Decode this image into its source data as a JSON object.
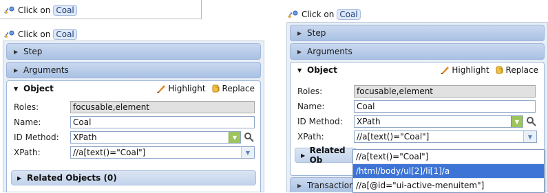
{
  "header": {
    "prefix": "Click on",
    "target": "Coal"
  },
  "bars": {
    "step": "Step",
    "arguments": "Arguments",
    "transactions": "Transactions"
  },
  "object": {
    "title": "Object",
    "highlight": "Highlight",
    "replace": "Replace",
    "labels": {
      "roles": "Roles:",
      "name": "Name:",
      "id_method": "ID Method:",
      "xpath": "XPath:"
    },
    "values": {
      "roles": "focusable,element",
      "name": "Coal",
      "id_method": "XPath",
      "xpath": "//a[text()=\"Coal\"]"
    }
  },
  "related": {
    "full": "Related Objects (0)",
    "truncated": "Related Ob"
  },
  "xpath_options": [
    "//a[text()=\"Coal\"]",
    "/html/body/ul[2]/li[1]/a",
    "//a[@id=\"ui-active-menuitem\"]"
  ],
  "selected_option_index": 1,
  "colors": {
    "accent": "#3d74d6",
    "panel_bar": "#a9c1e3",
    "id_button": "#9ec45c"
  },
  "icons": {
    "step": "drag-link-icon",
    "highlight": "highlighter-pen-icon",
    "replace": "replace-icon",
    "inspect": "magnifier-icon"
  }
}
